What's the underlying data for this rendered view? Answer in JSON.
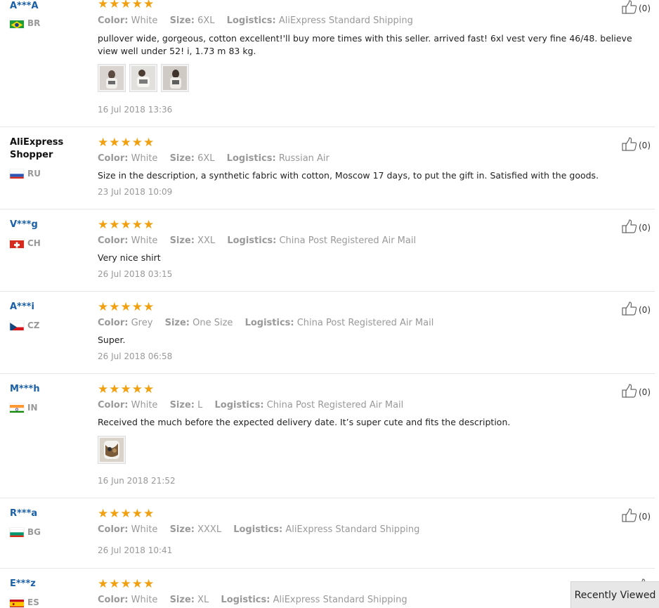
{
  "labels": {
    "color": "Color:",
    "size": "Size:",
    "logistics": "Logistics:"
  },
  "reviews": [
    {
      "user": "A***A",
      "country": "BR",
      "rating": 5,
      "color": "White",
      "size": "6XL",
      "logistics": "AliExpress Standard Shipping",
      "comment": "pullover wide, gorgeous, cotton excellent!'ll buy more times with this seller. arrived fast! 6xl vest very fine 46/48. believe view well under 52! i, 1.73 m 83 kg.",
      "photos": 3,
      "date": "16 Jul 2018 13:36",
      "likes": "(0)"
    },
    {
      "user": "AliExpress Shopper",
      "country": "RU",
      "rating": 5,
      "color": "White",
      "size": "6XL",
      "logistics": "Russian Air",
      "comment": "Size in the description, a synthetic fabric with cotton, Moscow 17 days, to put the gift in. Satisfied with the goods.",
      "photos": 0,
      "date": "23 Jul 2018 10:09",
      "likes": "(0)"
    },
    {
      "user": "V***g",
      "country": "CH",
      "rating": 5,
      "color": "White",
      "size": "XXL",
      "logistics": "China Post Registered Air Mail",
      "comment": "Very nice shirt",
      "photos": 0,
      "date": "26 Jul 2018 03:15",
      "likes": "(0)"
    },
    {
      "user": "A***i",
      "country": "CZ",
      "rating": 5,
      "color": "Grey",
      "size": "One Size",
      "logistics": "China Post Registered Air Mail",
      "comment": "Super.",
      "photos": 0,
      "date": "26 Jul 2018 06:58",
      "likes": "(0)"
    },
    {
      "user": "M***h",
      "country": "IN",
      "rating": 5,
      "color": "White",
      "size": "L",
      "logistics": "China Post Registered Air Mail",
      "comment": "Received the much before the expected delivery date. It’s super cute and fits the description.",
      "photos": 1,
      "date": "16 Jun 2018 21:52",
      "likes": "(0)"
    },
    {
      "user": "R***a",
      "country": "BG",
      "rating": 5,
      "color": "White",
      "size": "XXXL",
      "logistics": "AliExpress Standard Shipping",
      "comment": "",
      "photos": 0,
      "date": "26 Jul 2018 10:41",
      "likes": "(0)"
    },
    {
      "user": "E***z",
      "country": "ES",
      "rating": 5,
      "color": "White",
      "size": "XL",
      "logistics": "AliExpress Standard Shipping",
      "comment": "",
      "photos": 0,
      "date": "",
      "likes": ""
    }
  ],
  "recently_viewed": "Recently Viewed",
  "colors": {
    "star": "#f0a010",
    "username": "#1a5fa6",
    "muted": "#999999"
  },
  "icons": {
    "star": "star-icon",
    "like": "thumbs-up-icon"
  }
}
